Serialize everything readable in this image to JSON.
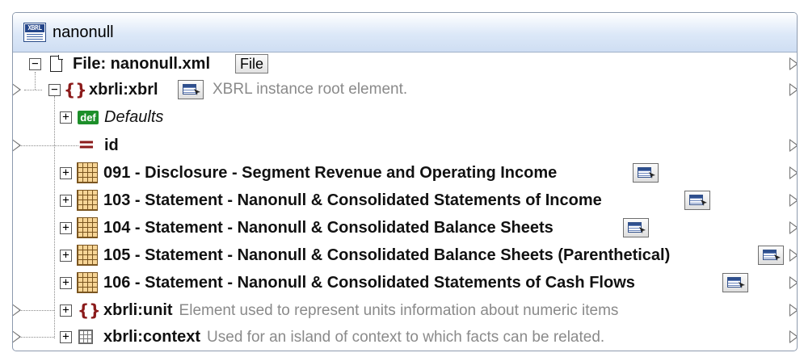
{
  "component": {
    "title": "nanonull"
  },
  "tree": {
    "file_row": {
      "label": "File: nanonull.xml",
      "button": "File"
    },
    "root": {
      "name": "xbrli:xbrl",
      "description": "XBRL instance root element."
    },
    "defaults": {
      "name": "Defaults",
      "icon_text": "def"
    },
    "id_attr": {
      "name": "id"
    },
    "tables": [
      "091 - Disclosure - Segment Revenue and Operating Income",
      "103 - Statement - Nanonull & Consolidated Statements of Income",
      "104 - Statement - Nanonull & Consolidated Balance Sheets",
      "105 - Statement - Nanonull & Consolidated Balance Sheets (Parenthetical)",
      "106 - Statement - Nanonull & Consolidated Statements of Cash Flows"
    ],
    "unit": {
      "name": "xbrli:unit",
      "description": "Element used to represent units information about numeric items"
    },
    "context": {
      "name": "xbrli:context",
      "description": "Used for an island of context to which facts can be related."
    }
  }
}
